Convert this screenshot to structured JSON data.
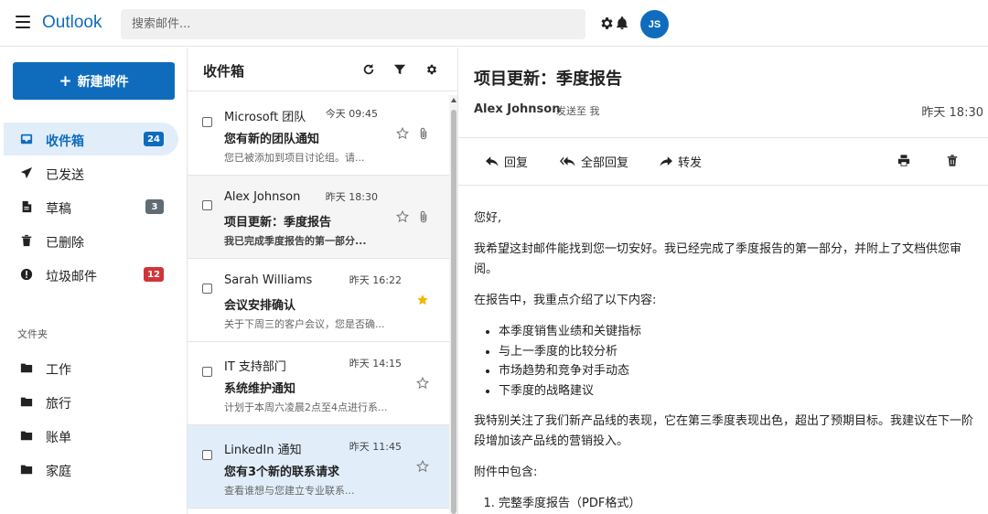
{
  "app": {
    "logo": "Outlook",
    "search_placeholder": "搜索邮件...",
    "avatar_initials": "JS",
    "accent_color": "#0f6cbd"
  },
  "sidebar": {
    "new_mail_label": "新建邮件",
    "items": [
      {
        "label": "收件箱",
        "icon": "inbox-icon",
        "badge": "24",
        "badge_color": "#0f6cbd",
        "active": true
      },
      {
        "label": "已发送",
        "icon": "send-icon"
      },
      {
        "label": "草稿",
        "icon": "draft-icon",
        "badge": "3",
        "badge_color": "#5f6b75"
      },
      {
        "label": "已删除",
        "icon": "trash-icon"
      },
      {
        "label": "垃圾邮件",
        "icon": "junk-icon",
        "badge": "12",
        "badge_color": "#d13438"
      }
    ],
    "folders_heading": "文件夹",
    "folders": [
      {
        "label": "工作",
        "icon": "folder-icon"
      },
      {
        "label": "旅行",
        "icon": "folder-icon"
      },
      {
        "label": "账单",
        "icon": "folder-icon"
      },
      {
        "label": "家庭",
        "icon": "folder-icon"
      }
    ]
  },
  "list": {
    "title": "收件箱",
    "mails": [
      {
        "sender": "Microsoft 团队",
        "time": "今天 09:45",
        "subject": "您有新的团队通知",
        "preview": "您已被添加到项目讨论组。请...",
        "starred": false,
        "attachment": true,
        "read": false,
        "selected": false
      },
      {
        "sender": "Alex Johnson",
        "time": "昨天 18:30",
        "subject": "项目更新：季度报告",
        "preview": "我已完成季度报告的第一部分...",
        "starred": false,
        "attachment": true,
        "read": true,
        "selected": false
      },
      {
        "sender": "Sarah Williams",
        "time": "昨天 16:22",
        "subject": "会议安排确认",
        "preview": "关于下周三的客户会议，您是否确...",
        "starred": true,
        "attachment": false,
        "read": false,
        "selected": false
      },
      {
        "sender": "IT 支持部门",
        "time": "昨天 14:15",
        "subject": "系统维护通知",
        "preview": "计划于本周六凌晨2点至4点进行系...",
        "starred": false,
        "attachment": false,
        "read": false,
        "selected": false
      },
      {
        "sender": "LinkedIn 通知",
        "time": "昨天 11:45",
        "subject": "您有3个新的联系请求",
        "preview": "查看谁想与您建立专业联系...",
        "starred": false,
        "attachment": false,
        "read": false,
        "selected": true
      }
    ]
  },
  "reader": {
    "subject": "项目更新：季度报告",
    "from": "Alex Johnson",
    "to": "发送至 我",
    "time": "昨天 18:30",
    "reply_label": "回复",
    "reply_all_label": "全部回复",
    "forward_label": "转发",
    "body": {
      "greeting": "您好,",
      "p1": "我希望这封邮件能找到您一切安好。我已经完成了季度报告的第一部分，并附上了文档供您审阅。",
      "p2": "在报告中，我重点介绍了以下内容:",
      "bullets": [
        "本季度销售业绩和关键指标",
        "与上一季度的比较分析",
        "市场趋势和竞争对手动态",
        "下季度的战略建议"
      ],
      "p3": "我特别关注了我们新产品线的表现，它在第三季度表现出色，超出了预期目标。我建议在下一阶段增加该产品线的营销投入。",
      "p4": "附件中包含:",
      "attachments": [
        "完整季度报告（PDF格式）"
      ]
    }
  }
}
